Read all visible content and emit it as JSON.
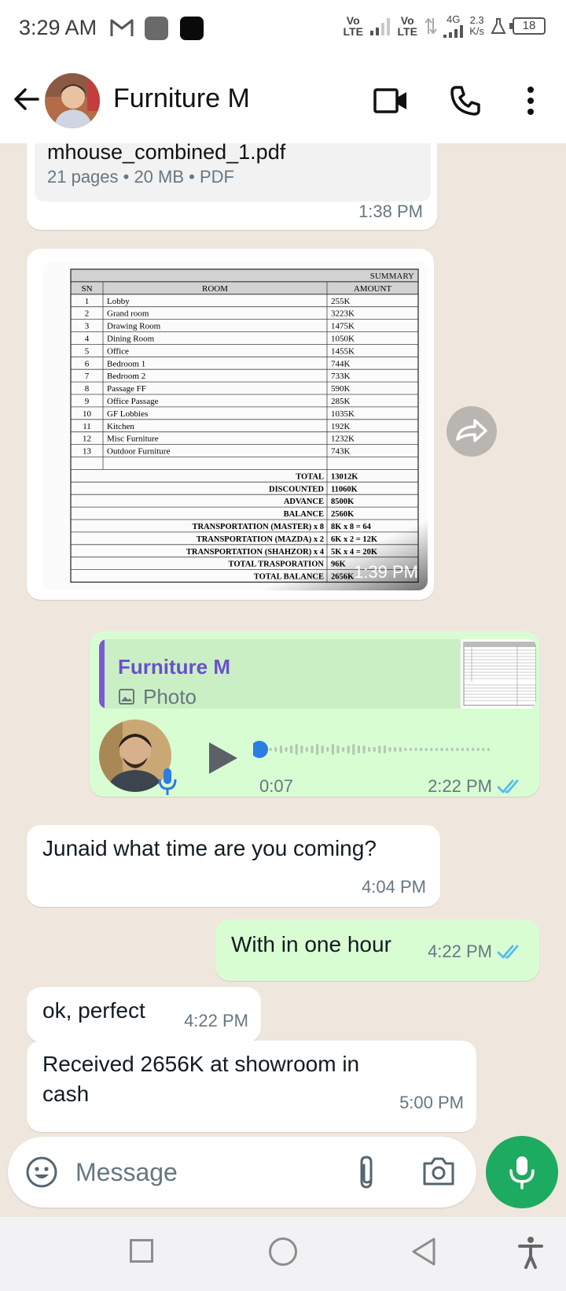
{
  "status_bar": {
    "time": "3:29 AM",
    "sim1": "Vo LTE",
    "sim2": "Vo LTE",
    "network": "4G",
    "speed_value": "2.3",
    "speed_unit": "K/s",
    "battery": "18"
  },
  "header": {
    "title": "Furniture M",
    "icons": [
      "back-arrow-icon",
      "video-call-icon",
      "phone-call-icon",
      "more-options-icon"
    ]
  },
  "messages": {
    "doc": {
      "filename": "mhouse_combined_1.pdf",
      "meta": "21 pages • 20 MB • PDF",
      "time": "1:38 PM"
    },
    "photo": {
      "time": "1:39 PM",
      "table": {
        "title": "SUMMARY",
        "headers": [
          "SN",
          "ROOM",
          "AMOUNT"
        ],
        "rows": [
          [
            "1",
            "Lobby",
            "255K"
          ],
          [
            "2",
            "Grand room",
            "3223K"
          ],
          [
            "3",
            "Drawing Room",
            "1475K"
          ],
          [
            "4",
            "Dining Room",
            "1050K"
          ],
          [
            "5",
            "Office",
            "1455K"
          ],
          [
            "6",
            "Bedroom 1",
            "744K"
          ],
          [
            "7",
            "Bedroom 2",
            "733K"
          ],
          [
            "8",
            "Passage FF",
            "590K"
          ],
          [
            "9",
            "Office Passage",
            "285K"
          ],
          [
            "10",
            "GF Lobbies",
            "1035K"
          ],
          [
            "11",
            "Kitchen",
            "192K"
          ],
          [
            "12",
            "Misc Furniture",
            "1232K"
          ],
          [
            "13",
            "Outdoor Furniture",
            "743K"
          ]
        ],
        "totals": [
          [
            "TOTAL",
            "13012K"
          ],
          [
            "DISCOUNTED",
            "11060K"
          ],
          [
            "ADVANCE",
            "8500K"
          ],
          [
            "BALANCE",
            "2560K"
          ],
          [
            "TRANSPORTATION (MASTER) x 8",
            "8K x 8 = 64"
          ],
          [
            "TRANSPORTATION (MAZDA) x 2",
            "6K x 2 = 12K"
          ],
          [
            "TRANSPORTATION (SHAHZOR) x 4",
            "5K x 4 = 20K"
          ],
          [
            "TOTAL TRASPORATION",
            "96K"
          ],
          [
            "TOTAL BALANCE",
            "2656K"
          ]
        ]
      }
    },
    "voice": {
      "quote_name": "Furniture M",
      "quote_type": "Photo",
      "duration": "0:07",
      "time": "2:22 PM",
      "progress": 0
    },
    "in1": {
      "text": "Junaid what time are you coming?",
      "time": "4:04 PM"
    },
    "out1": {
      "text": "With in one hour",
      "time": "4:22 PM"
    },
    "in2": {
      "text": "ok, perfect",
      "time": "4:22 PM"
    },
    "in3": {
      "line1": "Received 2656K at showroom in",
      "line2": "cash",
      "time": "5:00 PM"
    }
  },
  "input": {
    "placeholder": "Message"
  },
  "colors": {
    "incoming_bubble": "#ffffff",
    "outgoing_bubble": "#d9fdd3",
    "chat_bg": "#efe7dd",
    "read_ticks": "#53bdeb",
    "mic_button": "#1daa61",
    "quote_accent": "#7a5ad7"
  }
}
